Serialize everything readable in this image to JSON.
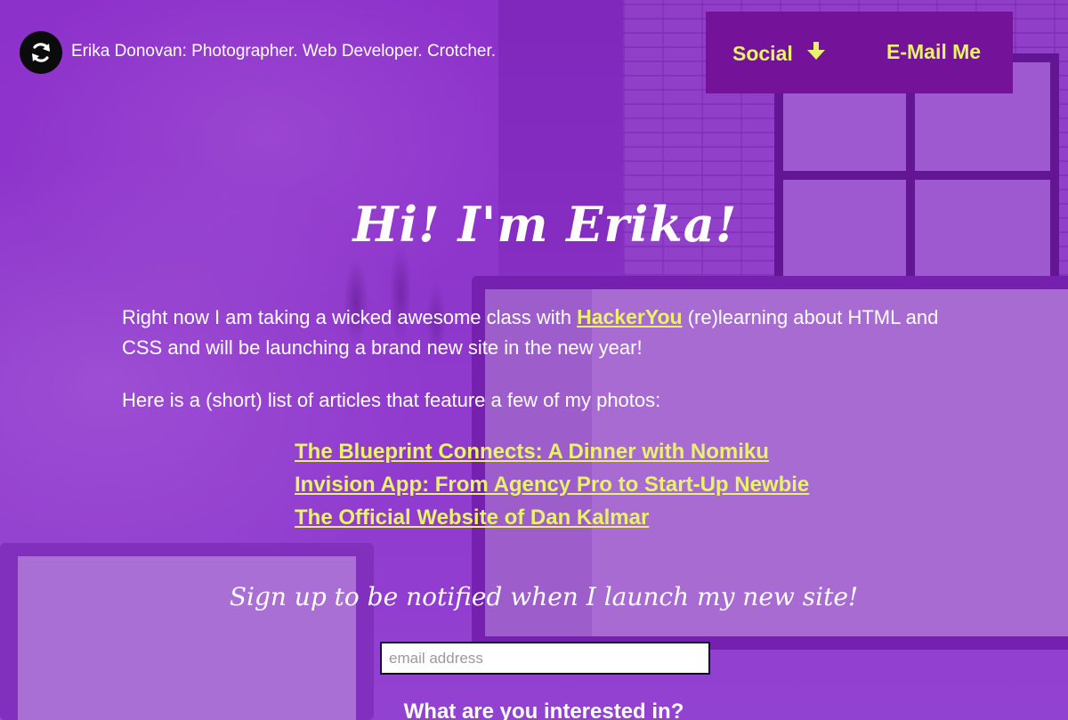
{
  "header": {
    "logo_icon": "refresh-arrows-icon",
    "site_title": "Erika Donovan: Photographer. Web Developer. Crotcher.",
    "nav": {
      "social_label": "Social",
      "social_icon": "arrow-down-icon",
      "email_label": "E-Mail Me"
    }
  },
  "hero": {
    "title": "Hi! I'm Erika!"
  },
  "intro": {
    "before_link": "Right now I am taking a wicked awesome class with ",
    "link_text": "HackerYou",
    "after_link": " (re)learning about HTML and CSS and will be launching a brand new site in the new year!"
  },
  "articles": {
    "intro": "Here is a (short) list of articles that feature a few of my photos:",
    "items": [
      "The Blueprint Connects: A Dinner with Nomiku",
      "Invision App: From Agency Pro to Start-Up Newbie",
      "The Official Website of Dan Kalmar"
    ]
  },
  "signup": {
    "heading": "Sign up to be notified when I launch my new site!",
    "email_placeholder": "email address",
    "interest_heading": "What are you interested in?"
  },
  "colors": {
    "accent": "#e9f26b",
    "nav_background": "#74139a",
    "page_tint": "#8a2fc9"
  }
}
